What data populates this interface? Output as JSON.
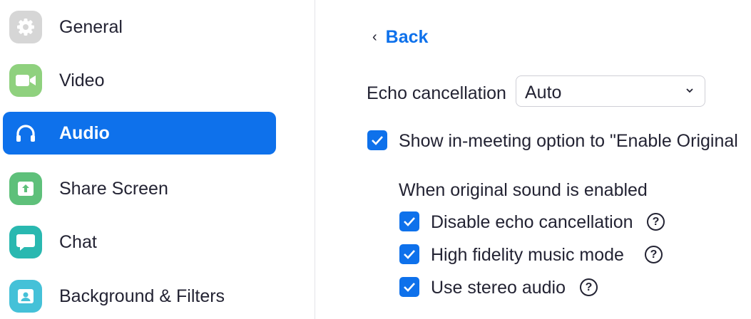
{
  "sidebar": {
    "items": [
      {
        "label": "General",
        "icon": "gear-icon",
        "color": "#d6d6d6",
        "active": false
      },
      {
        "label": "Video",
        "icon": "video-camera-icon",
        "color": "#8fd17e",
        "active": false
      },
      {
        "label": "Audio",
        "icon": "headphones-icon",
        "color": "#0e71eb",
        "active": true
      },
      {
        "label": "Share Screen",
        "icon": "share-screen-icon",
        "color": "#5ec07a",
        "active": false
      },
      {
        "label": "Chat",
        "icon": "chat-bubble-icon",
        "color": "#29b8b0",
        "active": false
      },
      {
        "label": "Background & Filters",
        "icon": "person-portrait-icon",
        "color": "#45c1d8",
        "active": false
      }
    ]
  },
  "main": {
    "back_label": "Back",
    "echo_cancellation": {
      "label": "Echo cancellation",
      "value": "Auto"
    },
    "show_option_label": "Show in-meeting option to \"Enable Original",
    "original_sound_heading": "When original sound is enabled",
    "options": [
      {
        "label": "Disable echo cancellation",
        "checked": true
      },
      {
        "label": "High fidelity music mode",
        "checked": true
      },
      {
        "label": "Use stereo audio",
        "checked": true
      }
    ],
    "help_glyph": "?"
  },
  "colors": {
    "accent": "#0e71eb",
    "text": "#232333"
  }
}
